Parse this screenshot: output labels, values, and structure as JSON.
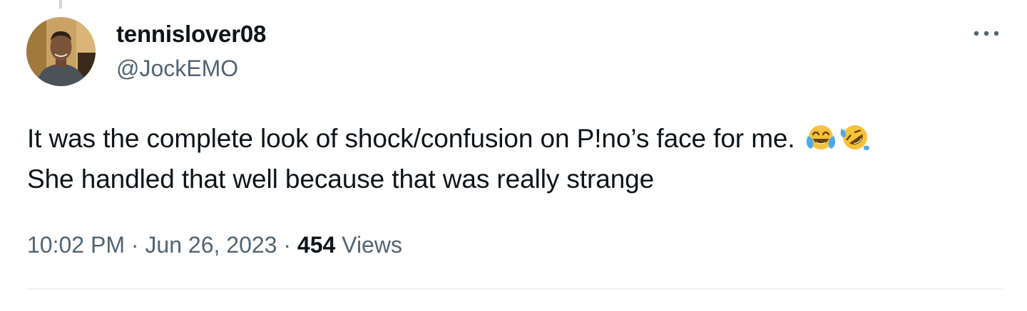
{
  "author": {
    "display_name": "tennislover08",
    "handle": "@JockEMO"
  },
  "tweet": {
    "line1": "It was the complete look of shock/confusion on P!no’s face for me.",
    "line2": "She handled that well because that was really strange",
    "emojis": [
      "face-with-tears-of-joy-icon",
      "rolling-on-the-floor-laughing-icon"
    ]
  },
  "meta": {
    "time": "10:02 PM",
    "separator": "·",
    "date": "Jun 26, 2023",
    "views_count": "454",
    "views_label": "Views"
  },
  "colors": {
    "text": "#0f1419",
    "secondary": "#536471",
    "divider": "#eff3f4",
    "emoji_face": "#f7c23b",
    "emoji_tears": "#4fa8e8"
  }
}
